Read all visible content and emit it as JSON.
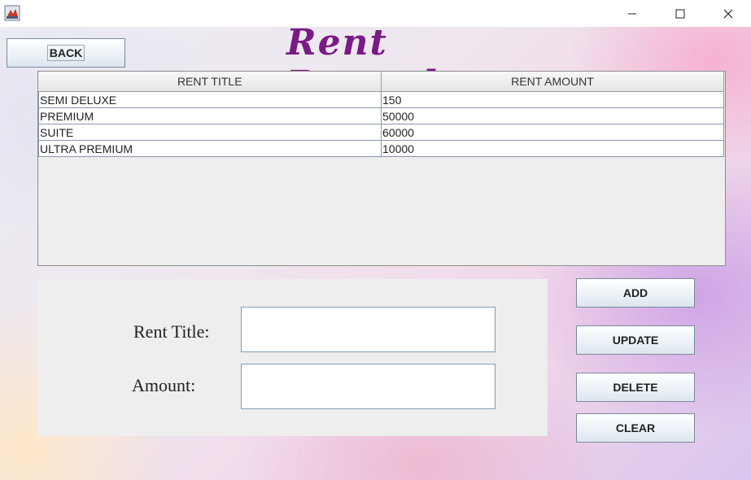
{
  "window": {
    "icon": "java-app-icon",
    "controls": [
      "minimize-icon",
      "maximize-icon",
      "close-icon"
    ]
  },
  "header": {
    "back_label": "BACK",
    "title": "Rent Record"
  },
  "table": {
    "columns": [
      "RENT TITLE",
      "RENT AMOUNT"
    ],
    "rows": [
      [
        "SEMI DELUXE",
        "150"
      ],
      [
        "PREMIUM",
        "50000"
      ],
      [
        "SUITE",
        "60000"
      ],
      [
        "ULTRA PREMIUM",
        "10000"
      ]
    ]
  },
  "form": {
    "rent_title_label": "Rent Title:",
    "rent_title_value": "",
    "amount_label": "Amount:",
    "amount_value": ""
  },
  "actions": {
    "add": "ADD",
    "update": "UPDATE",
    "delete": "DELETE",
    "clear": "CLEAR"
  },
  "colors": {
    "title": "#7a1a86",
    "panel": "#eeeeee",
    "field_border": "#7f9db9"
  }
}
